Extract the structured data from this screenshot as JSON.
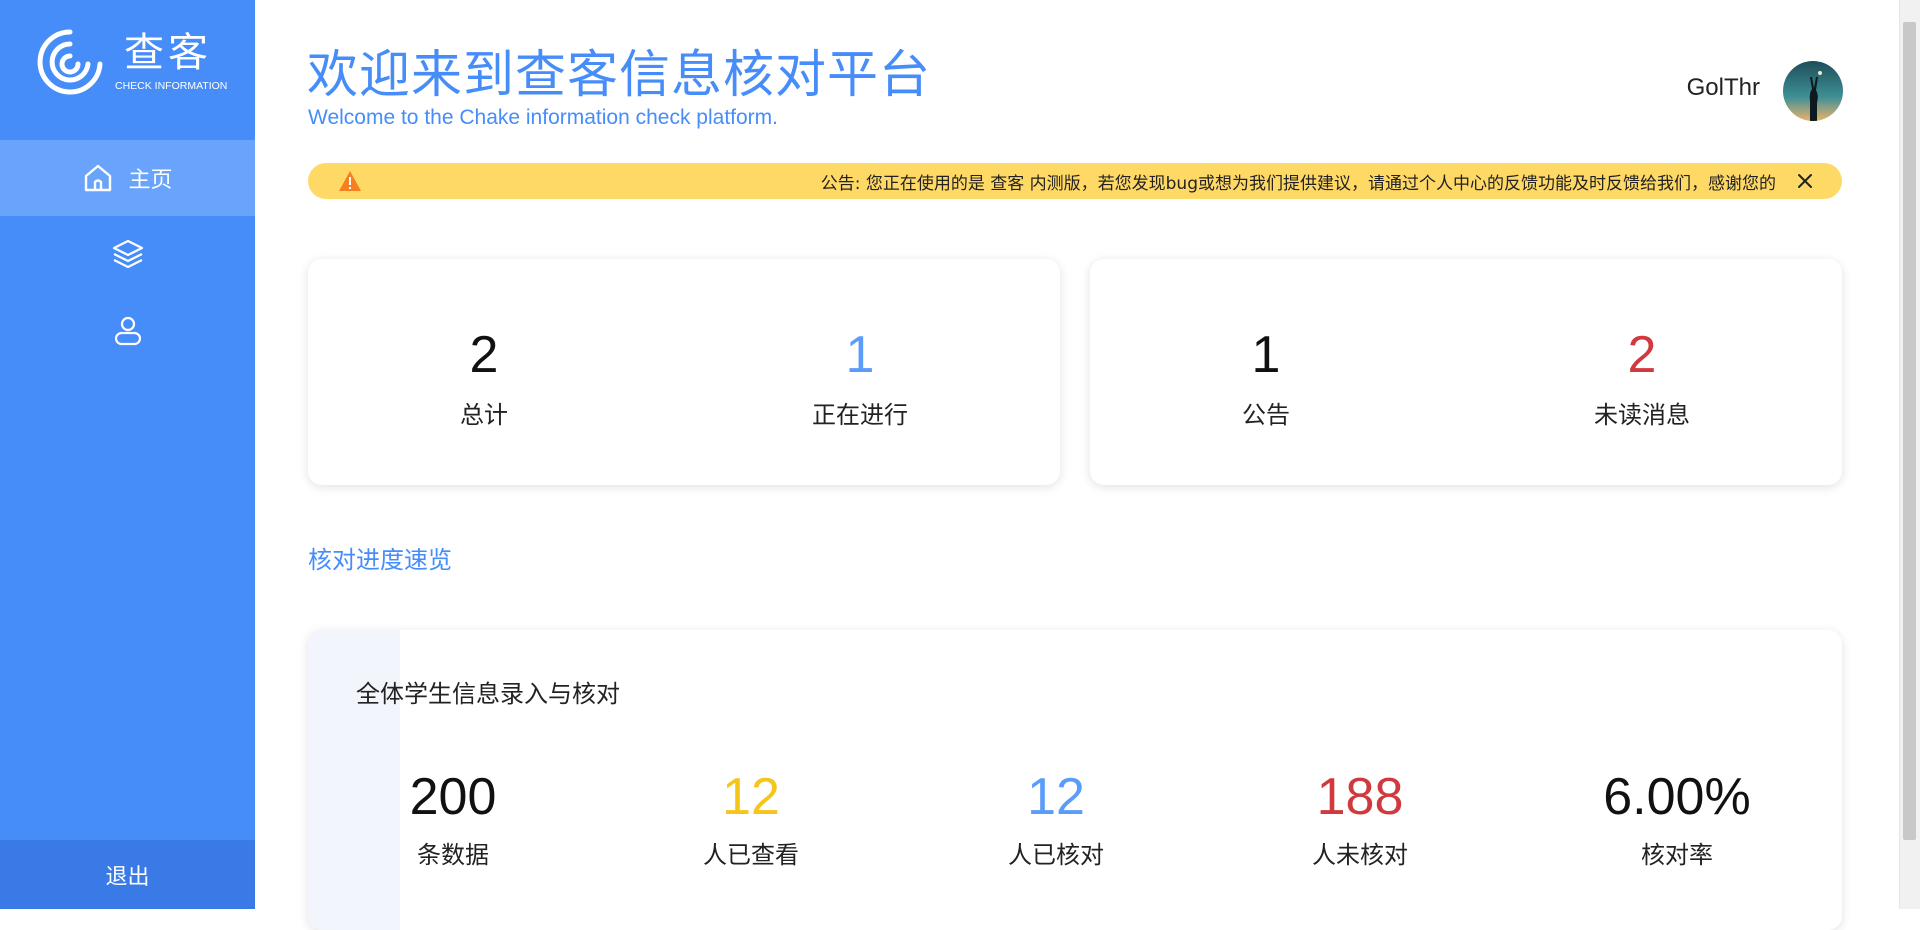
{
  "brand": {
    "name": "查客",
    "subtitle": "CHECK INFORMATION"
  },
  "sidebar": {
    "items": [
      {
        "label": "主页",
        "icon": "home-icon",
        "active": true
      },
      {
        "label": "",
        "icon": "layers-icon",
        "active": false
      },
      {
        "label": "",
        "icon": "user-icon",
        "active": false
      }
    ],
    "logout_label": "退出"
  },
  "header": {
    "title": "欢迎来到查客信息核对平台",
    "subtitle": "Welcome to the Chake information check platform.",
    "username": "GolThr"
  },
  "notice": {
    "text": "公告: 您正在使用的是 查客 内测版，若您发现bug或想为我们提供建议，请通过个人中心的反馈功能及时反馈给我们，感谢您的"
  },
  "stats": {
    "total": {
      "value": "2",
      "label": "总计"
    },
    "in_progress": {
      "value": "1",
      "label": "正在进行"
    },
    "announcements": {
      "value": "1",
      "label": "公告"
    },
    "unread": {
      "value": "2",
      "label": "未读消息"
    }
  },
  "progress_section": {
    "title": "核对进度速览",
    "card_title": "全体学生信息录入与核对",
    "items": [
      {
        "value": "200",
        "label": "条数据"
      },
      {
        "value": "12",
        "label": "人已查看"
      },
      {
        "value": "12",
        "label": "人已核对"
      },
      {
        "value": "188",
        "label": "人未核对"
      },
      {
        "value": "6.00%",
        "label": "核对率"
      }
    ]
  },
  "colors": {
    "primary": "#468df9",
    "warning": "#ffd966",
    "danger": "#d0393e",
    "yellow": "#f5c518",
    "blue_num": "#5b9cf8"
  }
}
